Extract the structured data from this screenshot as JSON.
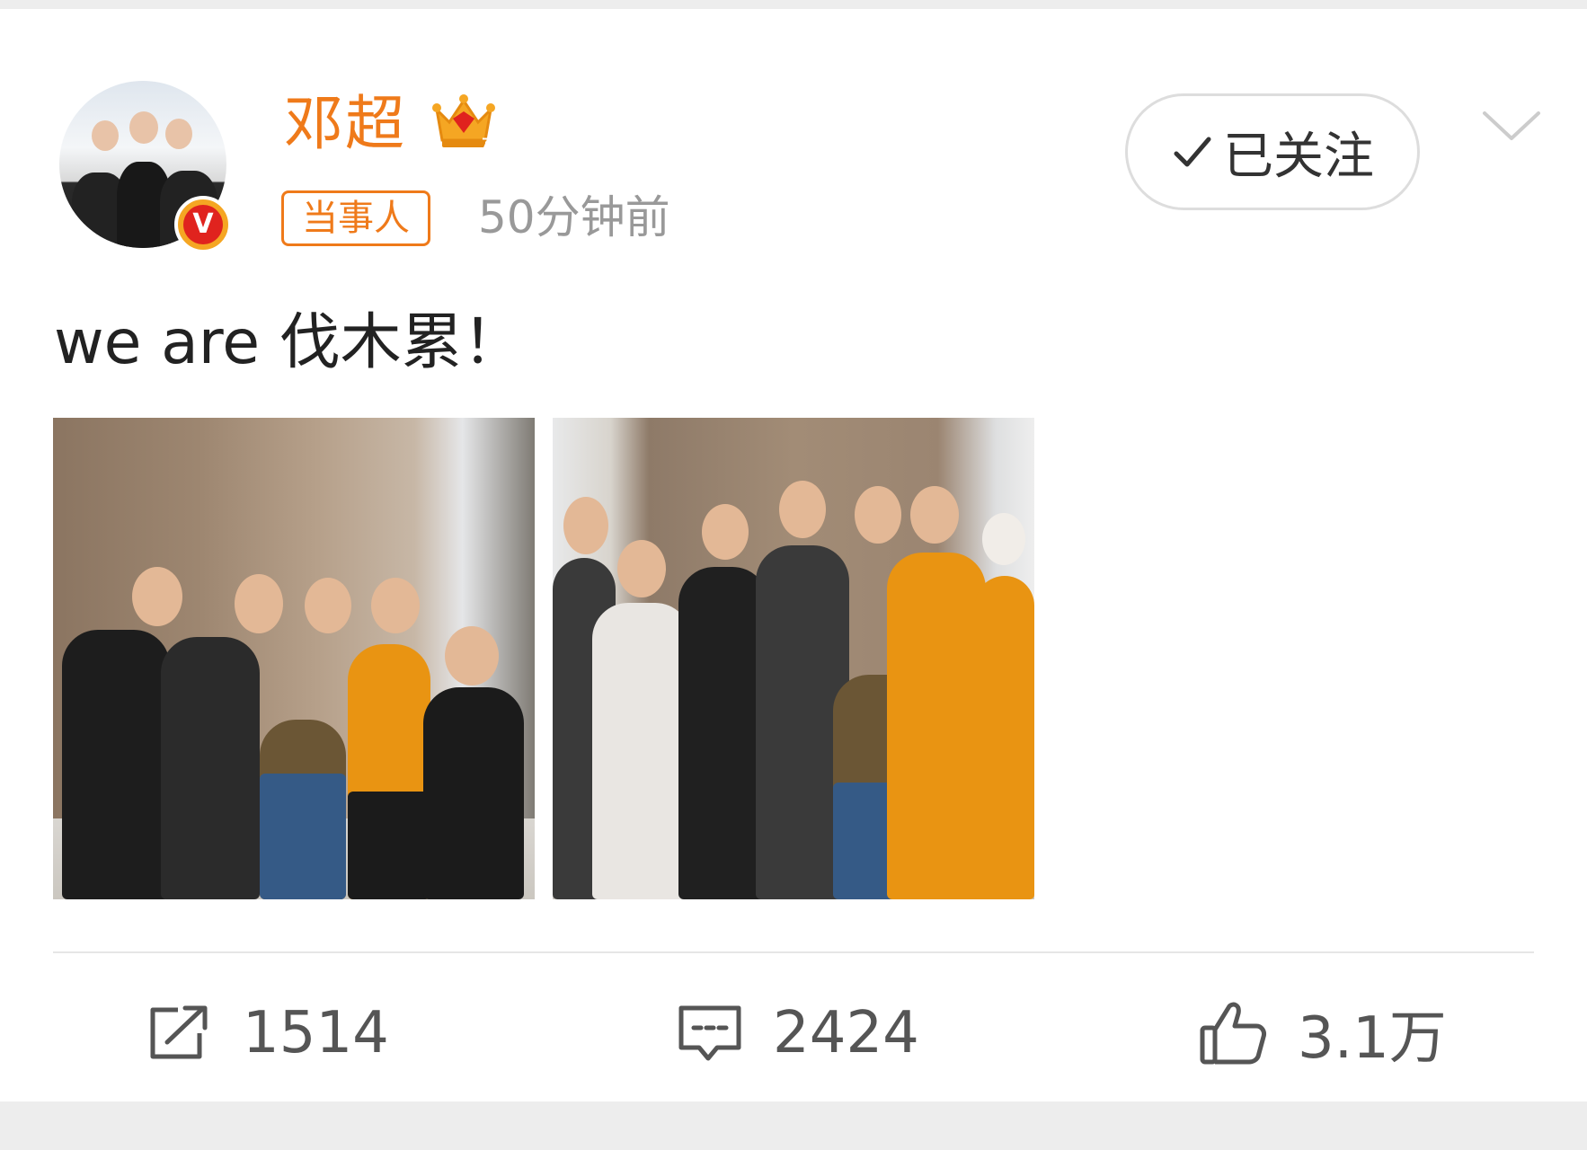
{
  "post": {
    "author": {
      "name": "邓超",
      "avatar_icon": "avatar-photo",
      "verified_icon": "verified-v-icon",
      "verified_label": "V",
      "member_icon": "crown-icon"
    },
    "tag": "当事人",
    "time": "50分钟前",
    "follow_label": "已关注",
    "text": "we are 伐木累！",
    "images": [
      {
        "alt": "photo-1"
      },
      {
        "alt": "photo-2"
      }
    ],
    "actions": {
      "repost_count": "1514",
      "comment_count": "2424",
      "like_count": "3.1万"
    }
  },
  "colors": {
    "accent_orange": "#ef7a1a",
    "text_gray": "#999999",
    "text_dark": "#222222",
    "badge_red": "#e0231e"
  }
}
